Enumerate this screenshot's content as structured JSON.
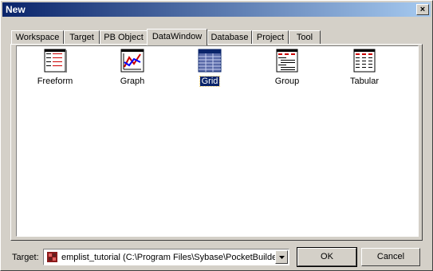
{
  "window": {
    "title": "New",
    "close_glyph": "×"
  },
  "tabs": [
    "Workspace",
    "Target",
    "PB Object",
    "DataWindow",
    "Database",
    "Project",
    "Tool"
  ],
  "active_tab": "DataWindow",
  "items": [
    {
      "label": "Freeform",
      "icon": "freeform-icon"
    },
    {
      "label": "Graph",
      "icon": "graph-icon"
    },
    {
      "label": "Grid",
      "icon": "grid-icon",
      "selected": true
    },
    {
      "label": "Group",
      "icon": "group-icon"
    },
    {
      "label": "Tabular",
      "icon": "tabular-icon"
    }
  ],
  "footer": {
    "target_label": "Target:",
    "target_value": "emplist_tutorial (C:\\Program Files\\Sybase\\PocketBuilder",
    "ok_label": "OK",
    "cancel_label": "Cancel"
  },
  "colors": {
    "title_bar": "#0a246a",
    "face": "#d4d0c8",
    "selection": "#0a246a"
  }
}
